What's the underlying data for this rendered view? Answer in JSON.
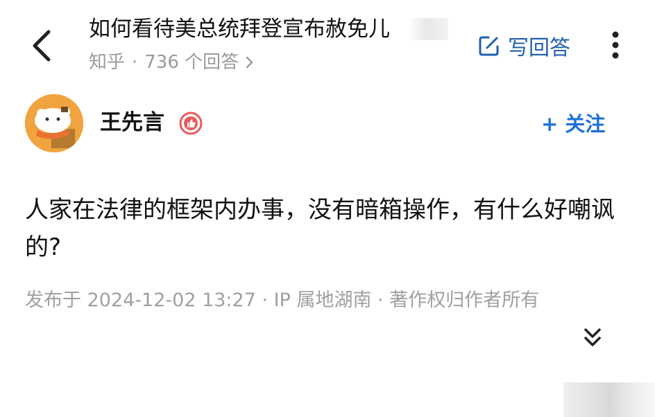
{
  "header": {
    "question_title": "如何看待美总统拜登宣布赦免儿",
    "source": "知乎",
    "answer_count": "736 个回答",
    "write_answer_label": "写回答",
    "icons": {
      "back": "chevron-left-icon",
      "write": "edit-square-icon",
      "more": "more-vertical-icon",
      "answers_chevron": "chevron-right-icon"
    }
  },
  "author": {
    "name": "王先言",
    "follow_label": "+ 关注",
    "badge_icon": "thumbs-up-badge-icon",
    "badge_color": "#e85a5a"
  },
  "answer": {
    "text": "人家在法律的框架内办事，没有暗箱操作，有什么好嘲讽的?",
    "meta": "发布于 2024-12-02 13:27 · IP 属地湖南 · 著作权归作者所有",
    "expand_icon": "double-chevron-down-icon"
  },
  "colors": {
    "accent_blue": "#1e6fd9",
    "write_blue": "#1e5fae",
    "meta_gray": "#9a9a9a",
    "avatar_orange": "#f0a33e"
  }
}
